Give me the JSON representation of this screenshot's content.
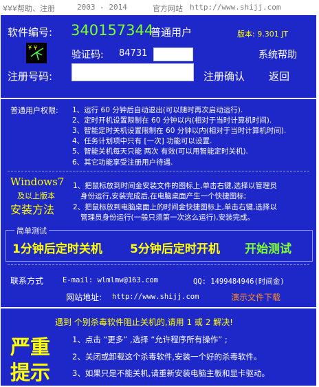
{
  "titlebar": {
    "menu": "¥¥¥帮助、注册",
    "years": "2003 - 2014",
    "site_label": "官方网站",
    "site_url": "http://www.shijj.com"
  },
  "colors": {
    "panel_bg": "#1e28c8",
    "accent_green": "#7cff2a",
    "accent_yellow": "#ffff00",
    "accent_orange": "#ff8c1a"
  },
  "icon": "logo-icon",
  "header": {
    "software_id_label": "软件编号:",
    "software_id": "340157344",
    "user_type": "普通用户",
    "version": "版本: 9.301 JT",
    "verify_label": "验证码:",
    "verify_code": "84731",
    "verify_value": "",
    "system_help": "系统帮助",
    "register_label": "注册号码:",
    "register_value": "",
    "register_confirm": "注册确认",
    "back": "返回"
  },
  "rules": {
    "title": "普通用户权限:",
    "items": [
      "1、运行 60 分钟后自动退出(可以随时再次启动运行).",
      "2、定时开机设置限制在 60 分钟以内(相对于当时计算机时间).",
      "3、智能定时关机设置限制在 60 分钟以内(相对于当时计算机时间).",
      "4、任务计划项中只有 [一次] 功能可以设置.",
      "5、智能关机每天只能 两次 有效(可以用智能定时关机).",
      "6、其它功能享受注册用户待遇."
    ]
  },
  "howto": {
    "win7": "Windows7",
    "above": "及以上版本",
    "method": "安装方法",
    "lines": [
      "1、把鼠标放到时间金安装文件的图标上,单击右键,选择以管理员",
      "身份运行,安装完成后,在电脑桌面产生一个快捷图标;",
      "2、把鼠标放到电脑桌面上的时间金快捷图标上,单击右键,选择以",
      "管理员身份运行(一般只须第一次这么运行),安装完成。"
    ]
  },
  "test": {
    "legend": "简单测试",
    "shutdown": "1分钟后定时关机",
    "startup": "5分钟后定时开机",
    "start": "开始测试"
  },
  "contact": {
    "label": "联系方式",
    "email": "E-mail: wlmlmw@163.com",
    "qq": "QQ: 1499484946(时间金)",
    "site_label": "网站地址:",
    "site_url": "http://www.shijj.com",
    "demo": "演示文件下载"
  },
  "warning": {
    "intro": "遇到 个别杀毒软件阻止关机的,请用 1 或 2 解决!",
    "big1": "严重",
    "big2": "提示",
    "items": [
      "1、点击 “更多” ,选择 “允许程序所有操作” ;",
      "2、关闭或卸载这个杀毒软件,安装一个好的杀毒软件。",
      "3、如果只是不能关机,请重新安装电脑主板和显卡驱动。"
    ]
  }
}
